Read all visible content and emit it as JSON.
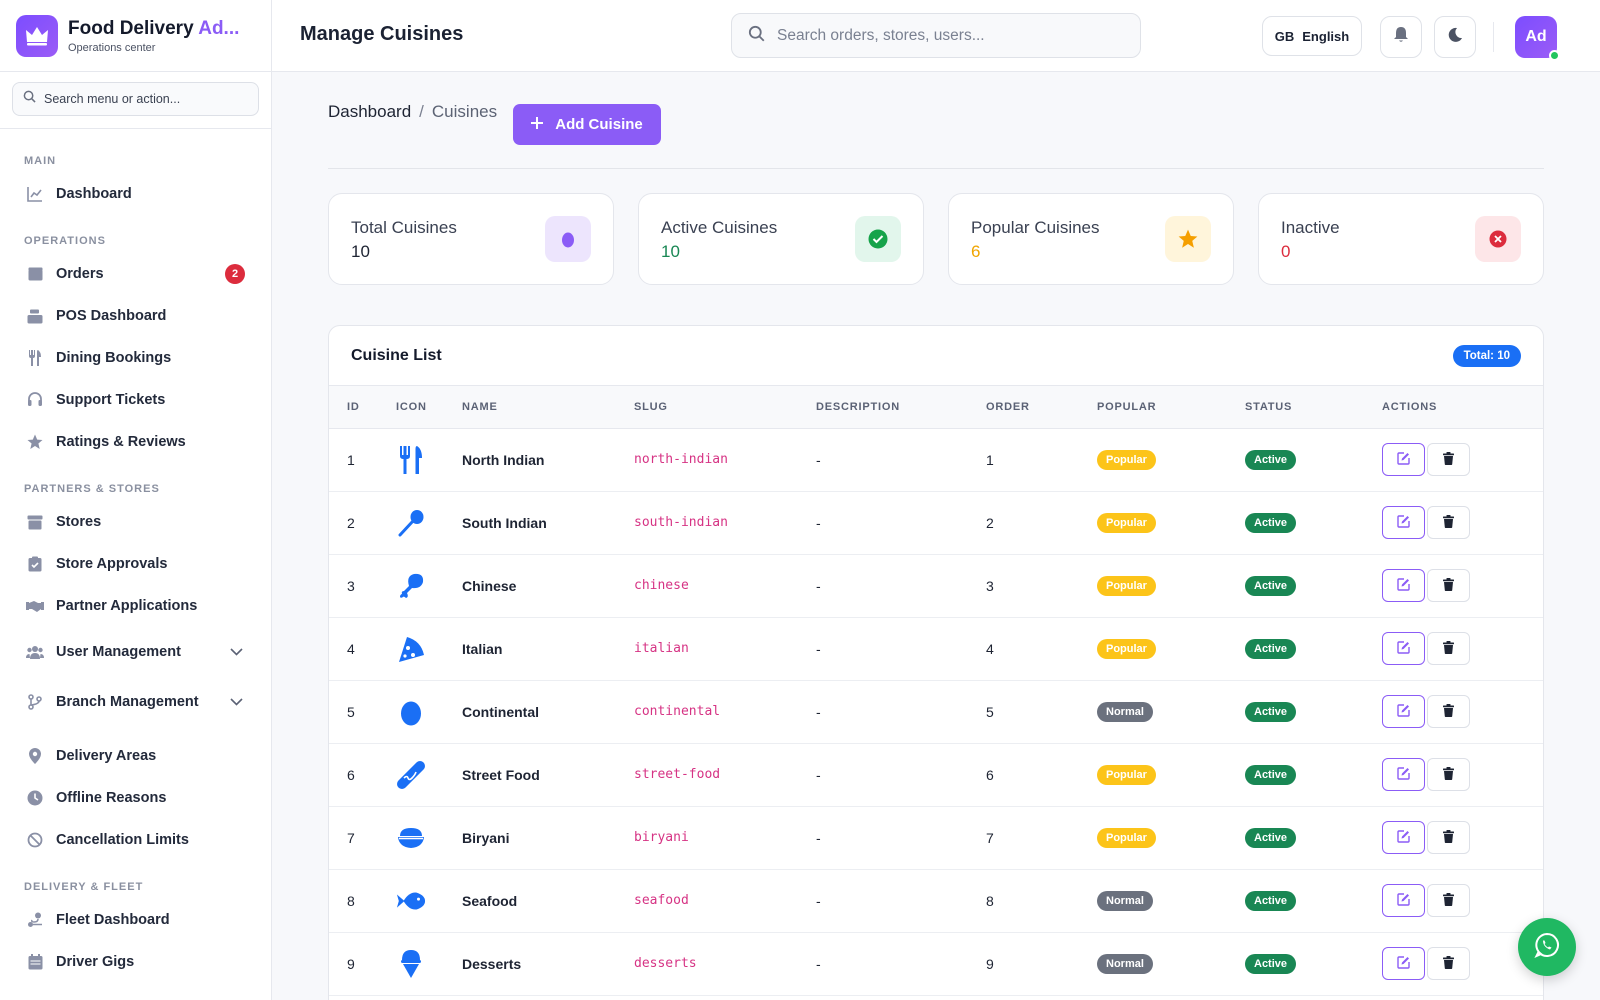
{
  "brand": {
    "title_main": "Food Delivery ",
    "title_accent": "Ad...",
    "subtitle": "Operations center"
  },
  "sidebar": {
    "search_placeholder": "Search menu or action...",
    "sections": {
      "main": "MAIN",
      "operations": "OPERATIONS",
      "partners": "PARTNERS & STORES",
      "delivery": "DELIVERY & FLEET"
    },
    "items": {
      "dashboard": "Dashboard",
      "orders": "Orders",
      "orders_badge": "2",
      "pos": "POS Dashboard",
      "dining": "Dining Bookings",
      "support": "Support Tickets",
      "ratings": "Ratings & Reviews",
      "stores": "Stores",
      "store_approvals": "Store Approvals",
      "partner_apps": "Partner Applications",
      "user_mgmt": "User Management",
      "branch_mgmt": "Branch Management",
      "delivery_areas": "Delivery Areas",
      "offline_reasons": "Offline Reasons",
      "cancel_limits": "Cancellation Limits",
      "fleet_dashboard": "Fleet Dashboard",
      "driver_gigs": "Driver Gigs"
    }
  },
  "header": {
    "title": "Manage Cuisines",
    "search_placeholder": "Search orders, stores, users...",
    "lang_code": "GB",
    "lang_label": "English",
    "avatar": "Ad"
  },
  "breadcrumb": {
    "root": "Dashboard",
    "sep": "/",
    "current": "Cuisines"
  },
  "add_button": "Add Cuisine",
  "stats": [
    {
      "label": "Total Cuisines",
      "value": "10",
      "color": "#1e2433"
    },
    {
      "label": "Active Cuisines",
      "value": "10",
      "color": "#198754"
    },
    {
      "label": "Popular Cuisines",
      "value": "6",
      "color": "#f0a500"
    },
    {
      "label": "Inactive",
      "value": "0",
      "color": "#dc2c3d"
    }
  ],
  "table": {
    "title": "Cuisine List",
    "total": "Total: 10",
    "columns": [
      "ID",
      "ICON",
      "NAME",
      "SLUG",
      "DESCRIPTION",
      "ORDER",
      "POPULAR",
      "STATUS",
      "ACTIONS"
    ],
    "rows": [
      {
        "id": "1",
        "icon": "utensils-icon",
        "name": "North Indian",
        "slug": "north-indian",
        "description": "-",
        "order": "1",
        "popular": "Popular",
        "status": "Active"
      },
      {
        "id": "2",
        "icon": "spoon-icon",
        "name": "South Indian",
        "slug": "south-indian",
        "description": "-",
        "order": "2",
        "popular": "Popular",
        "status": "Active"
      },
      {
        "id": "3",
        "icon": "drumstick-icon",
        "name": "Chinese",
        "slug": "chinese",
        "description": "-",
        "order": "3",
        "popular": "Popular",
        "status": "Active"
      },
      {
        "id": "4",
        "icon": "pizza-icon",
        "name": "Italian",
        "slug": "italian",
        "description": "-",
        "order": "4",
        "popular": "Popular",
        "status": "Active"
      },
      {
        "id": "5",
        "icon": "egg-icon",
        "name": "Continental",
        "slug": "continental",
        "description": "-",
        "order": "5",
        "popular": "Normal",
        "status": "Active"
      },
      {
        "id": "6",
        "icon": "hotdog-icon",
        "name": "Street Food",
        "slug": "street-food",
        "description": "-",
        "order": "6",
        "popular": "Popular",
        "status": "Active"
      },
      {
        "id": "7",
        "icon": "bowl-icon",
        "name": "Biryani",
        "slug": "biryani",
        "description": "-",
        "order": "7",
        "popular": "Popular",
        "status": "Active"
      },
      {
        "id": "8",
        "icon": "fish-icon",
        "name": "Seafood",
        "slug": "seafood",
        "description": "-",
        "order": "8",
        "popular": "Normal",
        "status": "Active"
      },
      {
        "id": "9",
        "icon": "ice-cream-icon",
        "name": "Desserts",
        "slug": "desserts",
        "description": "-",
        "order": "9",
        "popular": "Normal",
        "status": "Active"
      }
    ]
  },
  "colors": {
    "accent": "#8b5cf6",
    "icon_blue": "#1a6ff5",
    "popular": "#fcc419",
    "normal": "#6b717e",
    "active": "#198754",
    "whatsapp": "#20b862"
  }
}
